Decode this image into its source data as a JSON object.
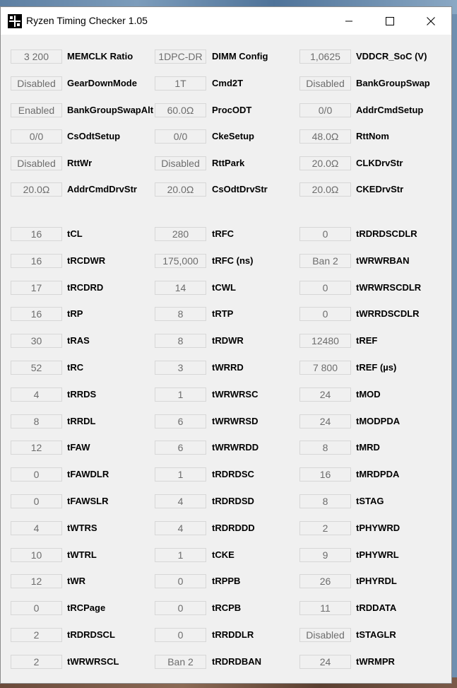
{
  "window": {
    "title": "Ryzen Timing Checker 1.05"
  },
  "settings": [
    [
      {
        "value": "3 200",
        "label": "MEMCLK Ratio"
      },
      {
        "value": "1DPC-DR",
        "label": "DIMM Config"
      },
      {
        "value": "1,0625",
        "label": "VDDCR_SoC (V)"
      }
    ],
    [
      {
        "value": "Disabled",
        "label": "GearDownMode"
      },
      {
        "value": "1T",
        "label": "Cmd2T"
      },
      {
        "value": "Disabled",
        "label": "BankGroupSwap"
      }
    ],
    [
      {
        "value": "Enabled",
        "label": "BankGroupSwapAlt"
      },
      {
        "value": "60.0Ω",
        "label": "ProcODT"
      },
      {
        "value": "0/0",
        "label": "AddrCmdSetup"
      }
    ],
    [
      {
        "value": "0/0",
        "label": "CsOdtSetup"
      },
      {
        "value": "0/0",
        "label": "CkeSetup"
      },
      {
        "value": "48.0Ω",
        "label": "RttNom"
      }
    ],
    [
      {
        "value": "Disabled",
        "label": "RttWr"
      },
      {
        "value": "Disabled",
        "label": "RttPark"
      },
      {
        "value": "20.0Ω",
        "label": "CLKDrvStr"
      }
    ],
    [
      {
        "value": "20.0Ω",
        "label": "AddrCmdDrvStr"
      },
      {
        "value": "20.0Ω",
        "label": "CsOdtDrvStr"
      },
      {
        "value": "20.0Ω",
        "label": "CKEDrvStr"
      }
    ]
  ],
  "timings": [
    [
      {
        "value": "16",
        "label": "tCL"
      },
      {
        "value": "280",
        "label": "tRFC"
      },
      {
        "value": "0",
        "label": "tRDRDSCDLR"
      }
    ],
    [
      {
        "value": "16",
        "label": "tRCDWR"
      },
      {
        "value": "175,000",
        "label": "tRFC (ns)"
      },
      {
        "value": "Ban 2",
        "label": "tWRWRBAN"
      }
    ],
    [
      {
        "value": "17",
        "label": "tRCDRD"
      },
      {
        "value": "14",
        "label": "tCWL"
      },
      {
        "value": "0",
        "label": "tWRWRSCDLR"
      }
    ],
    [
      {
        "value": "16",
        "label": "tRP"
      },
      {
        "value": "8",
        "label": "tRTP"
      },
      {
        "value": "0",
        "label": "tWRRDSCDLR"
      }
    ],
    [
      {
        "value": "30",
        "label": "tRAS"
      },
      {
        "value": "8",
        "label": "tRDWR"
      },
      {
        "value": "12480",
        "label": "tREF"
      }
    ],
    [
      {
        "value": "52",
        "label": "tRC"
      },
      {
        "value": "3",
        "label": "tWRRD"
      },
      {
        "value": "7 800",
        "label": "tREF (µs)"
      }
    ],
    [
      {
        "value": "4",
        "label": "tRRDS"
      },
      {
        "value": "1",
        "label": "tWRWRSC"
      },
      {
        "value": "24",
        "label": "tMOD"
      }
    ],
    [
      {
        "value": "8",
        "label": "tRRDL"
      },
      {
        "value": "6",
        "label": "tWRWRSD"
      },
      {
        "value": "24",
        "label": "tMODPDA"
      }
    ],
    [
      {
        "value": "12",
        "label": "tFAW"
      },
      {
        "value": "6",
        "label": "tWRWRDD"
      },
      {
        "value": "8",
        "label": "tMRD"
      }
    ],
    [
      {
        "value": "0",
        "label": "tFAWDLR"
      },
      {
        "value": "1",
        "label": "tRDRDSC"
      },
      {
        "value": "16",
        "label": "tMRDPDA"
      }
    ],
    [
      {
        "value": "0",
        "label": "tFAWSLR"
      },
      {
        "value": "4",
        "label": "tRDRDSD"
      },
      {
        "value": "8",
        "label": "tSTAG"
      }
    ],
    [
      {
        "value": "4",
        "label": "tWTRS"
      },
      {
        "value": "4",
        "label": "tRDRDDD"
      },
      {
        "value": "2",
        "label": "tPHYWRD"
      }
    ],
    [
      {
        "value": "10",
        "label": "tWTRL"
      },
      {
        "value": "1",
        "label": "tCKE"
      },
      {
        "value": "9",
        "label": "tPHYWRL"
      }
    ],
    [
      {
        "value": "12",
        "label": "tWR"
      },
      {
        "value": "0",
        "label": "tRPPB"
      },
      {
        "value": "26",
        "label": "tPHYRDL"
      }
    ],
    [
      {
        "value": "0",
        "label": "tRCPage"
      },
      {
        "value": "0",
        "label": "tRCPB"
      },
      {
        "value": "11",
        "label": "tRDDATA"
      }
    ],
    [
      {
        "value": "2",
        "label": "tRDRDSCL"
      },
      {
        "value": "0",
        "label": "tRRDDLR"
      },
      {
        "value": "Disabled",
        "label": "tSTAGLR"
      }
    ],
    [
      {
        "value": "2",
        "label": "tWRWRSCL"
      },
      {
        "value": "Ban 2",
        "label": "tRDRDBAN"
      },
      {
        "value": "24",
        "label": "tWRMPR"
      }
    ]
  ]
}
